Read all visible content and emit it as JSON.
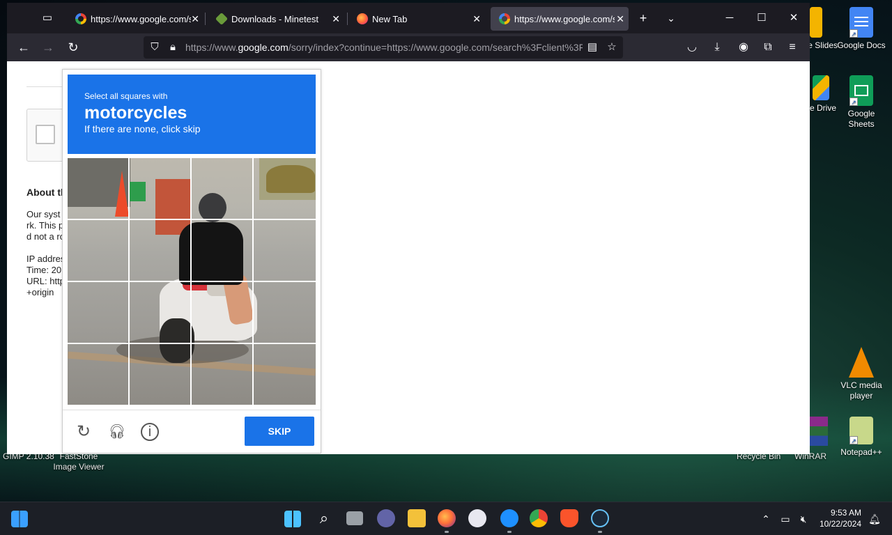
{
  "browser": {
    "tabs": [
      {
        "title": "https://www.google.com/s",
        "favicon": "google-icon",
        "active": false
      },
      {
        "title": "Downloads - Minetest",
        "favicon": "minetest-icon",
        "active": false
      },
      {
        "title": "New Tab",
        "favicon": "firefox-icon",
        "active": false
      },
      {
        "title": "https://www.google.com/s",
        "favicon": "google-icon",
        "active": true
      }
    ],
    "url_domain_prefix": "https://www.",
    "url_domain": "google.com",
    "url_rest": "/sorry/index?continue=https://www.google.com/search%3Fclient%3F"
  },
  "page": {
    "about_heading": "About th",
    "para_lines": [
      "Our syst",
      "rk. This p",
      "d not a ro"
    ],
    "ip_lines": [
      "IP addres",
      "Time: 20",
      "URL: http",
      "+origin"
    ]
  },
  "captcha": {
    "instruction": "Select all squares with",
    "target": "motorcycles",
    "subtext": "If there are none, click skip",
    "skip_label": "SKIP",
    "accent": "#1a73e8"
  },
  "desktop": {
    "icons": [
      {
        "label": "e Slides"
      },
      {
        "label": "Google Docs"
      },
      {
        "label": "e Drive"
      },
      {
        "label": "Google Sheets"
      },
      {
        "label": "VLC media player"
      },
      {
        "label": "Notepad++"
      }
    ],
    "bottom_labels": [
      "GIMP 2.10.38",
      "FastStone Image Viewer",
      "Recycle Bin",
      "WinRAR"
    ]
  },
  "taskbar": {
    "time": "9:53 AM",
    "date": "10/22/2024"
  }
}
